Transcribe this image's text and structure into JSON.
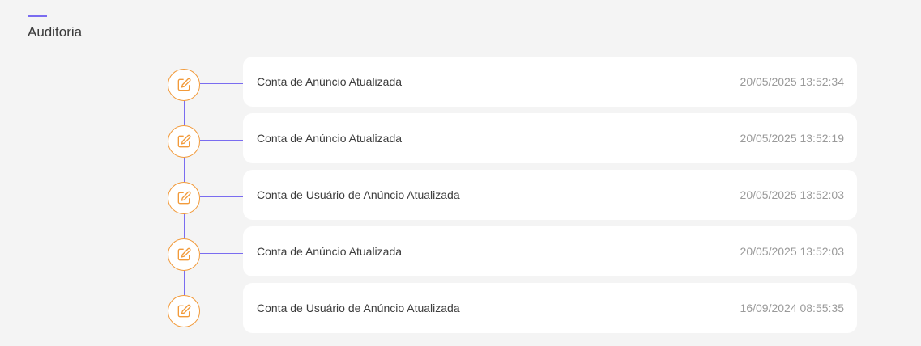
{
  "page": {
    "title": "Auditoria"
  },
  "colors": {
    "accent": "#7a6cf0",
    "icon": "#f29a3a",
    "background": "#f4f4f4",
    "card": "#ffffff"
  },
  "timeline": {
    "icon": "edit-icon",
    "items": [
      {
        "label": "Conta de Anúncio Atualizada",
        "timestamp": "20/05/2025 13:52:34"
      },
      {
        "label": "Conta de Anúncio Atualizada",
        "timestamp": "20/05/2025 13:52:19"
      },
      {
        "label": "Conta de Usuário de Anúncio Atualizada",
        "timestamp": "20/05/2025 13:52:03"
      },
      {
        "label": "Conta de Anúncio Atualizada",
        "timestamp": "20/05/2025 13:52:03"
      },
      {
        "label": "Conta de Usuário de Anúncio Atualizada",
        "timestamp": "16/09/2024 08:55:35"
      }
    ]
  }
}
